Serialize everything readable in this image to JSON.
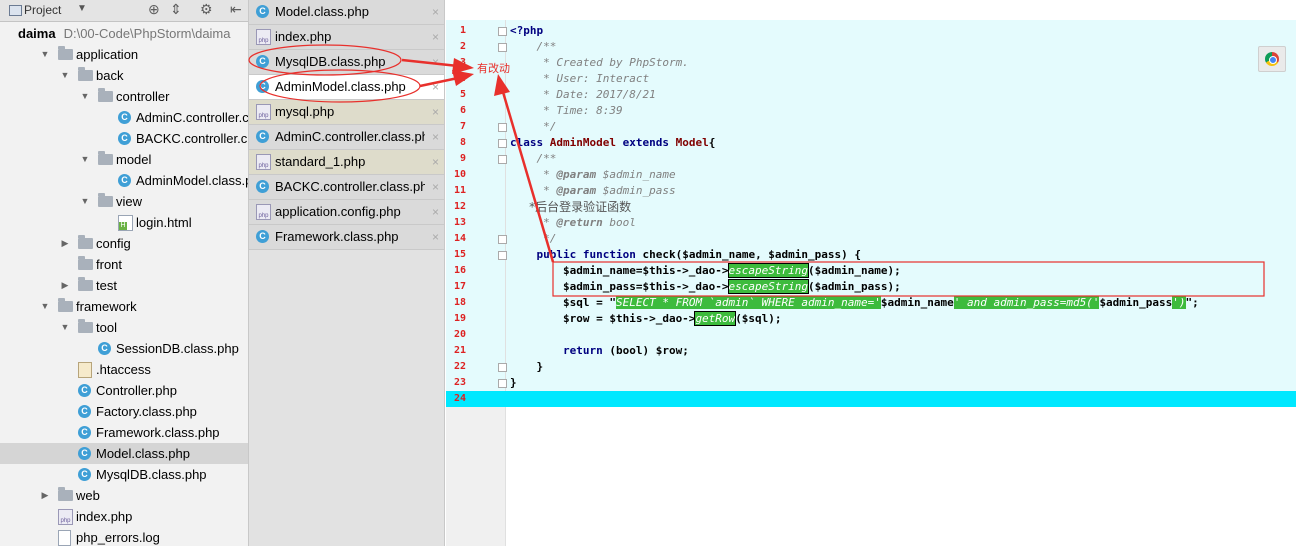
{
  "project_panel": {
    "title": "Project",
    "items": [
      {
        "label": "daima",
        "path": "D:\\00-Code\\PhpStorm\\daima",
        "type": "root",
        "depth": 0,
        "arrow": "down"
      },
      {
        "label": "application",
        "type": "folder",
        "depth": 1,
        "arrow": "down"
      },
      {
        "label": "back",
        "type": "folder",
        "depth": 2,
        "arrow": "down"
      },
      {
        "label": "controller",
        "type": "folder",
        "depth": 3,
        "arrow": "down"
      },
      {
        "label": "AdminC.controller.class.php",
        "type": "class",
        "depth": 4
      },
      {
        "label": "BACKC.controller.class.php",
        "type": "class",
        "depth": 4
      },
      {
        "label": "model",
        "type": "folder",
        "depth": 3,
        "arrow": "down"
      },
      {
        "label": "AdminModel.class.php",
        "type": "class",
        "depth": 4
      },
      {
        "label": "view",
        "type": "folder",
        "depth": 3,
        "arrow": "down"
      },
      {
        "label": "login.html",
        "type": "html",
        "depth": 4
      },
      {
        "label": "config",
        "type": "folder",
        "depth": 2,
        "arrow": "right"
      },
      {
        "label": "front",
        "type": "folder",
        "depth": 2
      },
      {
        "label": "test",
        "type": "folder",
        "depth": 2,
        "arrow": "right"
      },
      {
        "label": "framework",
        "type": "folder",
        "depth": 1,
        "arrow": "down"
      },
      {
        "label": "tool",
        "type": "folder",
        "depth": 2,
        "arrow": "down"
      },
      {
        "label": "SessionDB.class.php",
        "type": "class",
        "depth": 3
      },
      {
        "label": ".htaccess",
        "type": "htaccess",
        "depth": 2
      },
      {
        "label": "Controller.php",
        "type": "class",
        "depth": 2
      },
      {
        "label": "Factory.class.php",
        "type": "class",
        "depth": 2
      },
      {
        "label": "Framework.class.php",
        "type": "class",
        "depth": 2
      },
      {
        "label": "Model.class.php",
        "type": "class",
        "depth": 2,
        "selected": true
      },
      {
        "label": "MysqlDB.class.php",
        "type": "class",
        "depth": 2
      },
      {
        "label": "web",
        "type": "folder",
        "depth": 1,
        "arrow": "right"
      },
      {
        "label": "index.php",
        "type": "php",
        "depth": 1
      },
      {
        "label": "php_errors.log",
        "type": "text",
        "depth": 1
      }
    ]
  },
  "tabs": [
    {
      "label": "Model.class.php",
      "icon": "class",
      "style": "plain"
    },
    {
      "label": "index.php",
      "icon": "php",
      "style": "plain"
    },
    {
      "label": "MysqlDB.class.php",
      "icon": "class",
      "style": "plain"
    },
    {
      "label": "AdminModel.class.php",
      "icon": "class",
      "style": "active"
    },
    {
      "label": "mysql.php",
      "icon": "php",
      "style": "olive"
    },
    {
      "label": "AdminC.controller.class.php",
      "icon": "class",
      "style": "plain"
    },
    {
      "label": "standard_1.php",
      "icon": "php",
      "style": "olive"
    },
    {
      "label": "BACKC.controller.class.php",
      "icon": "class",
      "style": "plain"
    },
    {
      "label": "application.config.php",
      "icon": "php",
      "style": "plain"
    },
    {
      "label": "Framework.class.php",
      "icon": "class",
      "style": "plain"
    }
  ],
  "tab_close_glyph": "×",
  "editor": {
    "line_numbers": [
      "1",
      "2",
      "3",
      "4",
      "5",
      "6",
      "7",
      "8",
      "9",
      "10",
      "11",
      "12",
      "13",
      "14",
      "15",
      "16",
      "17",
      "18",
      "19",
      "20",
      "21",
      "22",
      "23",
      "24"
    ],
    "annotation": "有改动",
    "code": {
      "l1": "<?php",
      "l2": "    /**",
      "l3": "     * Created by PhpStorm.",
      "l4": "     * User: Interact",
      "l5": "     * Date: 2017/8/21",
      "l6": "     * Time: 8:39",
      "l7": "     */",
      "l8_kw1": "class",
      "l8_name": " AdminModel ",
      "l8_kw2": "extends",
      "l8_parent": " Model",
      "l8_end": "{",
      "l9": "    /**",
      "l10_pre": "     * ",
      "l10_tag": "@param",
      "l10_rest": " $admin_name",
      "l11_pre": "     * ",
      "l11_tag": "@param",
      "l11_rest": " $admin_pass",
      "l12": "     *后台登录验证函数",
      "l13_pre": "     * ",
      "l13_tag": "@return",
      "l13_rest": " bool",
      "l14": "     */",
      "l15_indent": "    ",
      "l15_kw1": "public",
      "l15_sp": " ",
      "l15_kw2": "function",
      "l15_rest": " check($admin_name, $admin_pass) {",
      "l16_pre": "        $admin_name=$this->_dao->",
      "l16_fn": "escapeString",
      "l16_post": "($admin_name);",
      "l17_pre": "        $admin_pass=$this->_dao->",
      "l17_fn": "escapeString",
      "l17_post": "($admin_pass);",
      "l18_pre": "        $sql = \"",
      "l18_s1": "SELECT * FROM `admin` WHERE admin_name='",
      "l18_v1": "$admin_name",
      "l18_s2": "' and admin_pass=md5('",
      "l18_v2": "$admin_pass",
      "l18_s3": "')",
      "l18_end": "\";",
      "l19_pre": "        $row = $this->_dao->",
      "l19_fn": "getRow",
      "l19_post": "($sql);",
      "l20": "",
      "l21_pre": "        ",
      "l21_kw": "return",
      "l21_rest": " (bool) $row;",
      "l22": "    }",
      "l23": "}",
      "l24": ""
    }
  }
}
